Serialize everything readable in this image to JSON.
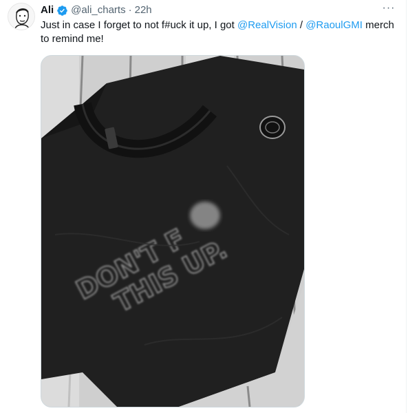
{
  "tweet": {
    "author_name": "Ali",
    "author_handle": "@ali_charts",
    "separator": "·",
    "time": "22h",
    "more_label": "···",
    "text_part1": "Just in case I forget to not f#uck it up, I got ",
    "mention1": "@RealVision",
    "text_part2": " / ",
    "mention2": "@RaoulGMI",
    "text_part3": " merch to remind me!",
    "shirt_print_line1": "DON'T F",
    "shirt_print_line2": "THIS UP.",
    "verified_color": "#1d9bf0",
    "link_color": "#1d9bf0"
  }
}
